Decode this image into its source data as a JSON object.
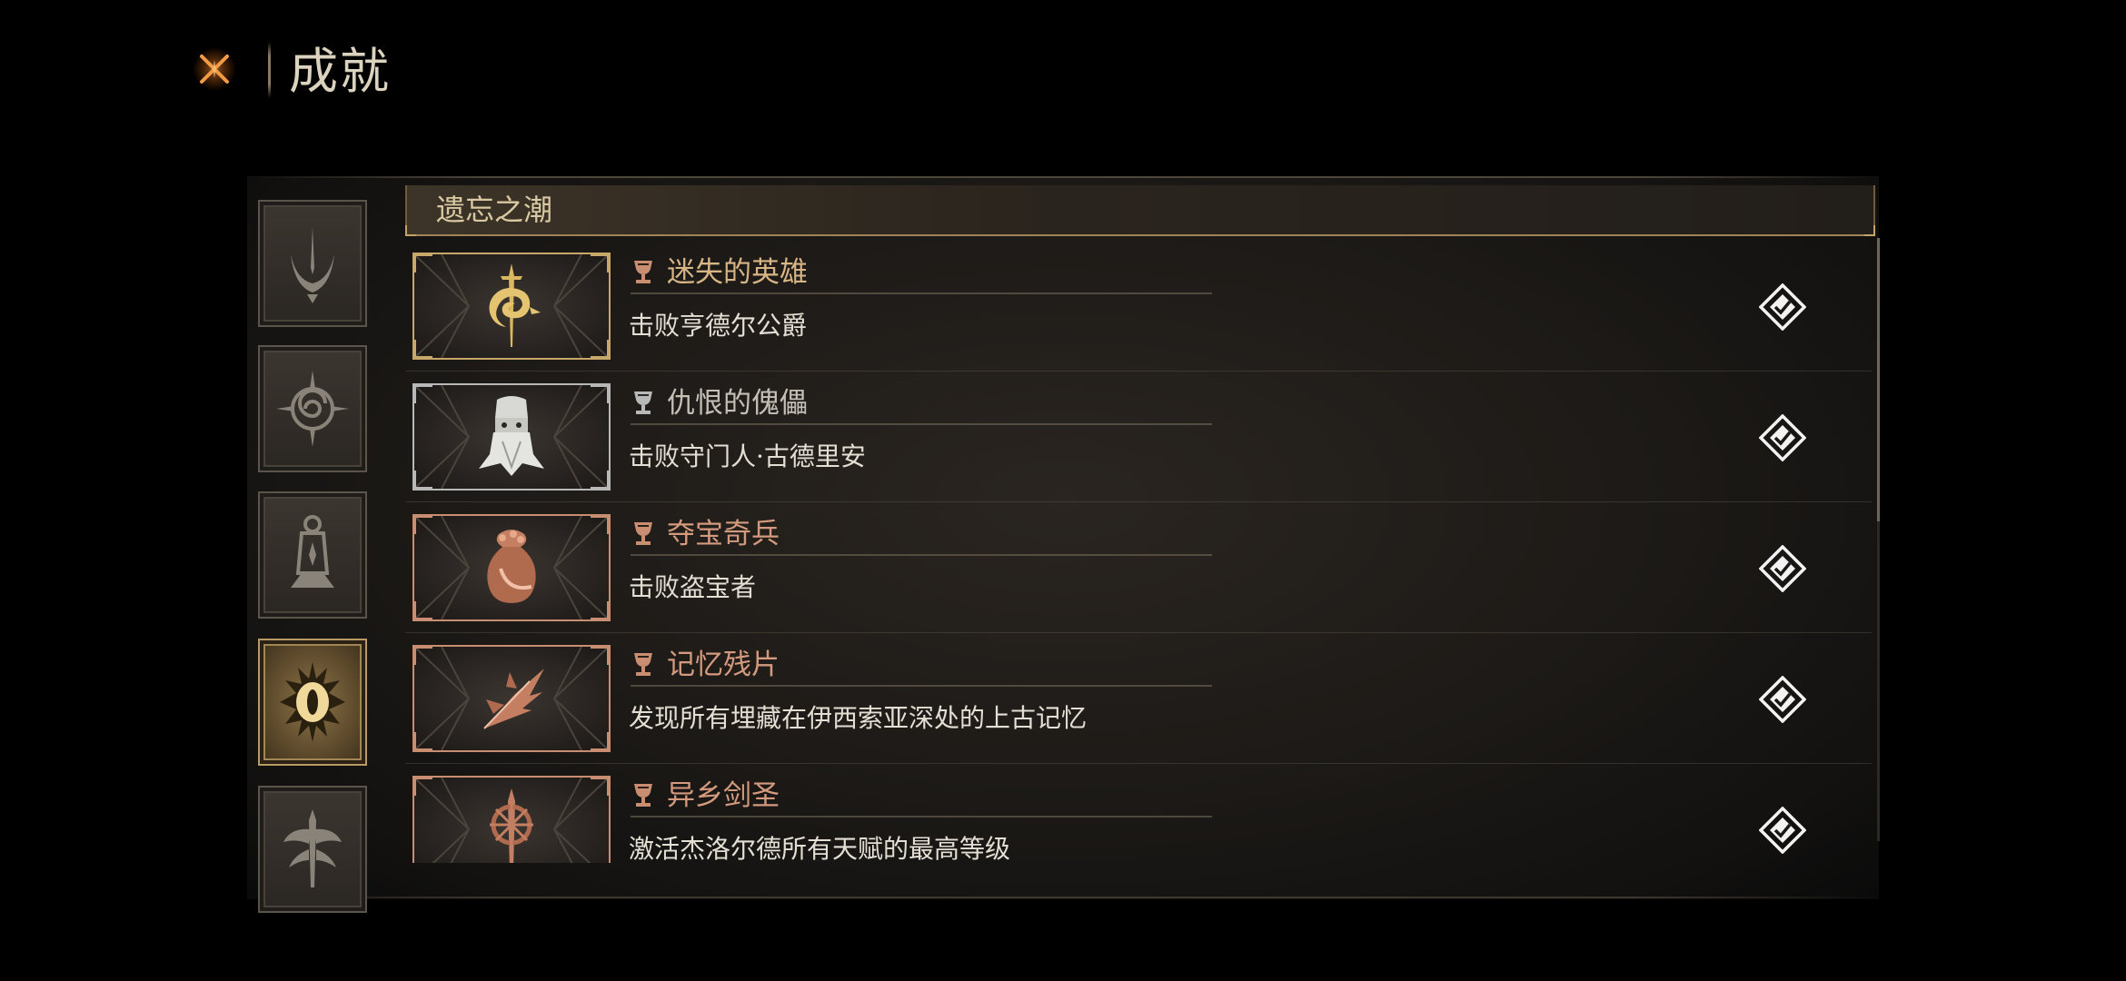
{
  "header": {
    "title": "成就"
  },
  "colors": {
    "gold": "#c8a86a",
    "bronze": "#c98e71",
    "silver": "#b8b8b8",
    "background": "#000000"
  },
  "sidebar": {
    "categories": [
      {
        "icon": "eclipse-sigil-icon",
        "active": false
      },
      {
        "icon": "spiral-compass-icon",
        "active": false
      },
      {
        "icon": "lantern-shrine-icon",
        "active": false
      },
      {
        "icon": "radiant-eye-icon",
        "active": true
      },
      {
        "icon": "winged-sword-icon",
        "active": false
      }
    ]
  },
  "section": {
    "title": "遗忘之潮"
  },
  "achievements": [
    {
      "tier": "gold",
      "emblem": "dragon-sword-emblem-icon",
      "title": "迷失的英雄",
      "description": "击败亨德尔公爵"
    },
    {
      "tier": "silver",
      "emblem": "bearded-golem-emblem-icon",
      "title": "仇恨的傀儡",
      "description": "击败守门人·古德里安"
    },
    {
      "tier": "bronze",
      "emblem": "treasure-sack-emblem-icon",
      "title": "夺宝奇兵",
      "description": "击败盗宝者"
    },
    {
      "tier": "bronze",
      "emblem": "shattered-leaf-emblem-icon",
      "title": "记忆残片",
      "description": "发现所有埋藏在伊西索亚深处的上古记忆"
    },
    {
      "tier": "bronze",
      "emblem": "spiked-sword-emblem-icon",
      "title": "异乡剑圣",
      "description": "激活杰洛尔德所有天赋的最高等级"
    }
  ]
}
